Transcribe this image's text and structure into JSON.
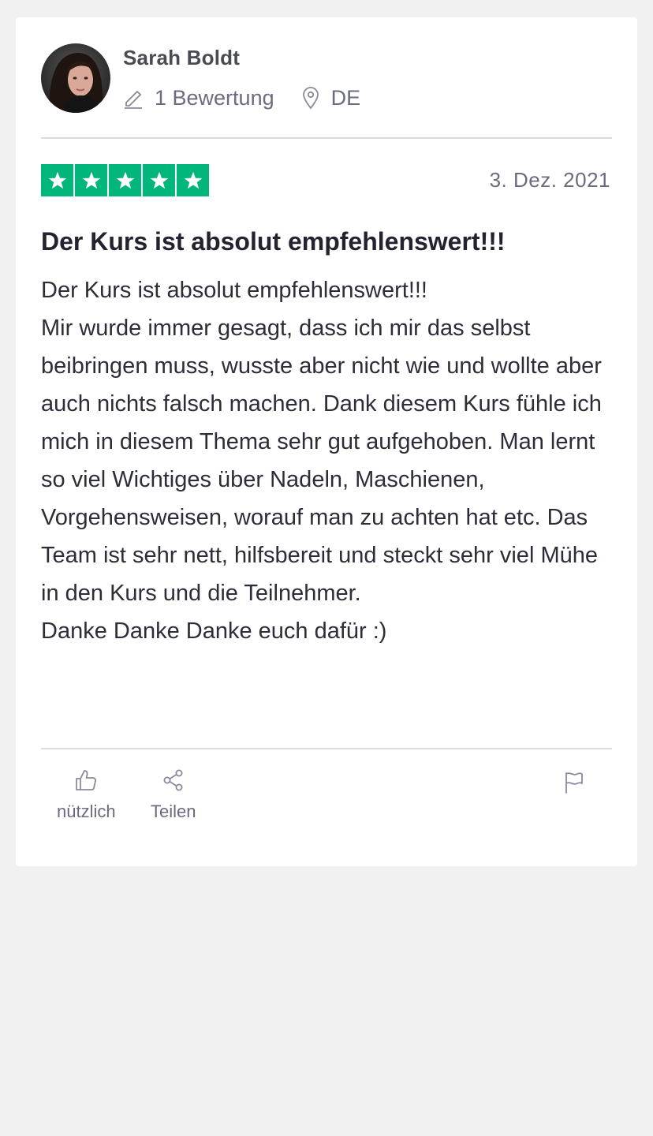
{
  "reviewer": {
    "name": "Sarah Boldt",
    "review_count": "1 Bewertung",
    "country": "DE",
    "avatar_icon": "user-photo"
  },
  "review": {
    "rating": 5,
    "rating_max": 5,
    "star_color": "#00b67a",
    "date": "3. Dez. 2021",
    "title": "Der Kurs ist absolut empfehlenswert!!!",
    "body": "Der Kurs ist absolut empfehlenswert!!!\nMir wurde immer gesagt, dass ich mir das selbst beibringen muss, wusste aber nicht wie und wollte aber auch nichts falsch machen. Dank diesem Kurs fühle ich mich in diesem Thema sehr gut aufgehoben. Man lernt so viel Wichtiges über Nadeln, Maschienen, Vorgehensweisen, worauf man zu achten hat etc. Das Team ist sehr nett, hilfsbereit und steckt sehr viel Mühe in den Kurs und die Teilnehmer.\nDanke Danke Danke euch dafür :)"
  },
  "actions": {
    "useful_label": "nützlich",
    "useful_icon": "thumbs-up-icon",
    "share_label": "Teilen",
    "share_icon": "share-icon",
    "report_icon": "flag-icon"
  }
}
